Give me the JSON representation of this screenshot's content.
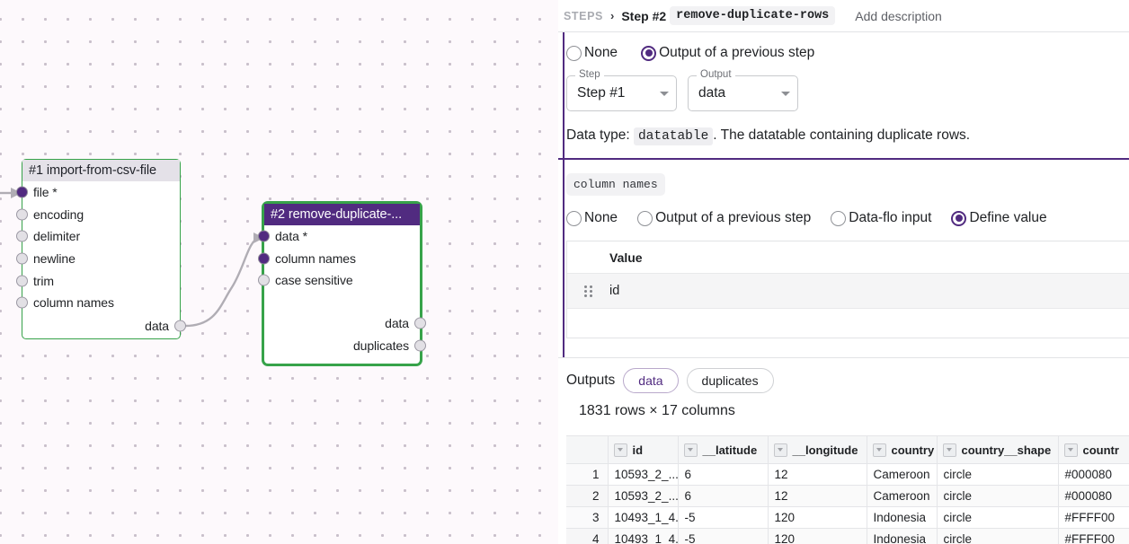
{
  "canvas": {
    "nodes": [
      {
        "id": "node1",
        "title": "#1 import-from-csv-file",
        "inputs": [
          {
            "label": "file *",
            "filled": true
          },
          {
            "label": "encoding",
            "filled": false
          },
          {
            "label": "delimiter",
            "filled": false
          },
          {
            "label": "newline",
            "filled": false
          },
          {
            "label": "trim",
            "filled": false
          },
          {
            "label": "column names",
            "filled": false
          }
        ],
        "outputs": [
          {
            "label": "data",
            "filled": false
          }
        ]
      },
      {
        "id": "node2",
        "title": "#2 remove-duplicate-...",
        "inputs": [
          {
            "label": "data *",
            "filled": true
          },
          {
            "label": "column names",
            "filled": true
          },
          {
            "label": "case sensitive",
            "filled": false
          }
        ],
        "outputs": [
          {
            "label": "data",
            "filled": false
          },
          {
            "label": "duplicates",
            "filled": false
          }
        ]
      }
    ]
  },
  "breadcrumb": {
    "steps_label": "STEPS",
    "chevron": "›",
    "step_label": "Step #2",
    "step_name": "remove-duplicate-rows",
    "add_description": "Add description"
  },
  "data_section": {
    "options": [
      {
        "label": "None",
        "selected": false
      },
      {
        "label": "Output of a previous step",
        "selected": true
      }
    ],
    "step_select": {
      "legend": "Step",
      "value": "Step #1"
    },
    "output_select": {
      "legend": "Output",
      "value": "data"
    },
    "datatype_prefix": "Data type:",
    "datatype_code": "datatable",
    "datatype_suffix": ".  The datatable containing duplicate rows."
  },
  "columns_section": {
    "param_name": "column names",
    "options": [
      {
        "label": "None",
        "selected": false
      },
      {
        "label": "Output of a previous step",
        "selected": false
      },
      {
        "label": "Data-flo input",
        "selected": false
      },
      {
        "label": "Define value",
        "selected": true
      }
    ],
    "table": {
      "header": "Value",
      "rows": [
        "id"
      ]
    }
  },
  "outputs_section": {
    "label": "Outputs",
    "tabs": [
      {
        "label": "data",
        "active": true
      },
      {
        "label": "duplicates",
        "active": false
      }
    ],
    "dimensions": "1831 rows × 17 columns",
    "grid": {
      "rownum_header": "",
      "columns": [
        "id",
        "__latitude",
        "__longitude",
        "country",
        "country__shape",
        "countr"
      ],
      "rows": [
        {
          "n": "1",
          "cells": [
            "10593_2_...",
            "6",
            "12",
            "Cameroon",
            "circle",
            "#000080"
          ]
        },
        {
          "n": "2",
          "cells": [
            "10593_2_...",
            "6",
            "12",
            "Cameroon",
            "circle",
            "#000080"
          ]
        },
        {
          "n": "3",
          "cells": [
            "10493_1_4...",
            "-5",
            "120",
            "Indonesia",
            "circle",
            "#FFFF00"
          ]
        },
        {
          "n": "4",
          "cells": [
            "10493_1_4...",
            "-5",
            "120",
            "Indonesia",
            "circle",
            "#FFFF00"
          ]
        }
      ]
    }
  },
  "colors": {
    "accent": "#512b80",
    "node_border": "#37a34a",
    "canvas_bg": "#fdf9fc",
    "grid_dot": "#c9c0cb"
  }
}
